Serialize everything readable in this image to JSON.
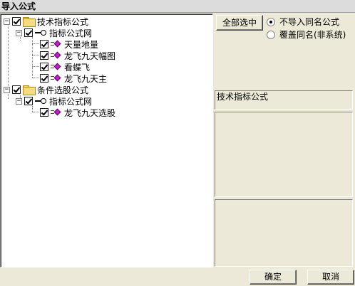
{
  "window": {
    "title": "导入公式"
  },
  "tree": {
    "groups": [
      {
        "label": "技术指标公式",
        "checked": true,
        "expanded": true,
        "subgroups": [
          {
            "label": "指标公式网",
            "checked": true,
            "items": [
              {
                "label": "天量地量",
                "checked": true
              },
              {
                "label": "龙飞九天幅图",
                "checked": true
              },
              {
                "label": "看蝶飞",
                "checked": true
              },
              {
                "label": "龙飞九天主",
                "checked": true
              }
            ]
          }
        ]
      },
      {
        "label": "条件选股公式",
        "checked": true,
        "expanded": true,
        "subgroups": [
          {
            "label": "指标公式网",
            "checked": true,
            "items": [
              {
                "label": "龙飞九天选股",
                "checked": true
              }
            ]
          }
        ]
      }
    ]
  },
  "controls": {
    "select_all_label": "全部选中",
    "radio_no_import": "不导入同名公式",
    "radio_overwrite": "覆盖同名(非系统)",
    "selected_radio": "no_import"
  },
  "info": {
    "formula_type": "技术指标公式"
  },
  "footer": {
    "ok_label": "确定",
    "cancel_label": "取消"
  },
  "colors": {
    "background": "#ece9d8",
    "tree_background": "#ffffff",
    "leaf_icon": "#c020c0",
    "folder": "#f6dd7a"
  }
}
